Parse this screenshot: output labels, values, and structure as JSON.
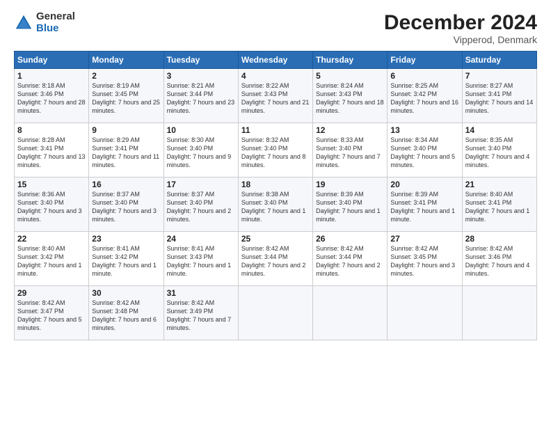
{
  "logo": {
    "general": "General",
    "blue": "Blue"
  },
  "header": {
    "month": "December 2024",
    "location": "Vipperod, Denmark"
  },
  "days_of_week": [
    "Sunday",
    "Monday",
    "Tuesday",
    "Wednesday",
    "Thursday",
    "Friday",
    "Saturday"
  ],
  "weeks": [
    [
      {
        "day": "1",
        "sunrise": "8:18 AM",
        "sunset": "3:46 PM",
        "daylight": "7 hours and 28 minutes."
      },
      {
        "day": "2",
        "sunrise": "8:19 AM",
        "sunset": "3:45 PM",
        "daylight": "7 hours and 25 minutes."
      },
      {
        "day": "3",
        "sunrise": "8:21 AM",
        "sunset": "3:44 PM",
        "daylight": "7 hours and 23 minutes."
      },
      {
        "day": "4",
        "sunrise": "8:22 AM",
        "sunset": "3:43 PM",
        "daylight": "7 hours and 21 minutes."
      },
      {
        "day": "5",
        "sunrise": "8:24 AM",
        "sunset": "3:43 PM",
        "daylight": "7 hours and 18 minutes."
      },
      {
        "day": "6",
        "sunrise": "8:25 AM",
        "sunset": "3:42 PM",
        "daylight": "7 hours and 16 minutes."
      },
      {
        "day": "7",
        "sunrise": "8:27 AM",
        "sunset": "3:41 PM",
        "daylight": "7 hours and 14 minutes."
      }
    ],
    [
      {
        "day": "8",
        "sunrise": "8:28 AM",
        "sunset": "3:41 PM",
        "daylight": "7 hours and 13 minutes."
      },
      {
        "day": "9",
        "sunrise": "8:29 AM",
        "sunset": "3:41 PM",
        "daylight": "7 hours and 11 minutes."
      },
      {
        "day": "10",
        "sunrise": "8:30 AM",
        "sunset": "3:40 PM",
        "daylight": "7 hours and 9 minutes."
      },
      {
        "day": "11",
        "sunrise": "8:32 AM",
        "sunset": "3:40 PM",
        "daylight": "7 hours and 8 minutes."
      },
      {
        "day": "12",
        "sunrise": "8:33 AM",
        "sunset": "3:40 PM",
        "daylight": "7 hours and 7 minutes."
      },
      {
        "day": "13",
        "sunrise": "8:34 AM",
        "sunset": "3:40 PM",
        "daylight": "7 hours and 5 minutes."
      },
      {
        "day": "14",
        "sunrise": "8:35 AM",
        "sunset": "3:40 PM",
        "daylight": "7 hours and 4 minutes."
      }
    ],
    [
      {
        "day": "15",
        "sunrise": "8:36 AM",
        "sunset": "3:40 PM",
        "daylight": "7 hours and 3 minutes."
      },
      {
        "day": "16",
        "sunrise": "8:37 AM",
        "sunset": "3:40 PM",
        "daylight": "7 hours and 3 minutes."
      },
      {
        "day": "17",
        "sunrise": "8:37 AM",
        "sunset": "3:40 PM",
        "daylight": "7 hours and 2 minutes."
      },
      {
        "day": "18",
        "sunrise": "8:38 AM",
        "sunset": "3:40 PM",
        "daylight": "7 hours and 1 minute."
      },
      {
        "day": "19",
        "sunrise": "8:39 AM",
        "sunset": "3:40 PM",
        "daylight": "7 hours and 1 minute."
      },
      {
        "day": "20",
        "sunrise": "8:39 AM",
        "sunset": "3:41 PM",
        "daylight": "7 hours and 1 minute."
      },
      {
        "day": "21",
        "sunrise": "8:40 AM",
        "sunset": "3:41 PM",
        "daylight": "7 hours and 1 minute."
      }
    ],
    [
      {
        "day": "22",
        "sunrise": "8:40 AM",
        "sunset": "3:42 PM",
        "daylight": "7 hours and 1 minute."
      },
      {
        "day": "23",
        "sunrise": "8:41 AM",
        "sunset": "3:42 PM",
        "daylight": "7 hours and 1 minute."
      },
      {
        "day": "24",
        "sunrise": "8:41 AM",
        "sunset": "3:43 PM",
        "daylight": "7 hours and 1 minute."
      },
      {
        "day": "25",
        "sunrise": "8:42 AM",
        "sunset": "3:44 PM",
        "daylight": "7 hours and 2 minutes."
      },
      {
        "day": "26",
        "sunrise": "8:42 AM",
        "sunset": "3:44 PM",
        "daylight": "7 hours and 2 minutes."
      },
      {
        "day": "27",
        "sunrise": "8:42 AM",
        "sunset": "3:45 PM",
        "daylight": "7 hours and 3 minutes."
      },
      {
        "day": "28",
        "sunrise": "8:42 AM",
        "sunset": "3:46 PM",
        "daylight": "7 hours and 4 minutes."
      }
    ],
    [
      {
        "day": "29",
        "sunrise": "8:42 AM",
        "sunset": "3:47 PM",
        "daylight": "7 hours and 5 minutes."
      },
      {
        "day": "30",
        "sunrise": "8:42 AM",
        "sunset": "3:48 PM",
        "daylight": "7 hours and 6 minutes."
      },
      {
        "day": "31",
        "sunrise": "8:42 AM",
        "sunset": "3:49 PM",
        "daylight": "7 hours and 7 minutes."
      },
      null,
      null,
      null,
      null
    ]
  ],
  "labels": {
    "sunrise": "Sunrise:",
    "sunset": "Sunset:",
    "daylight": "Daylight:"
  }
}
